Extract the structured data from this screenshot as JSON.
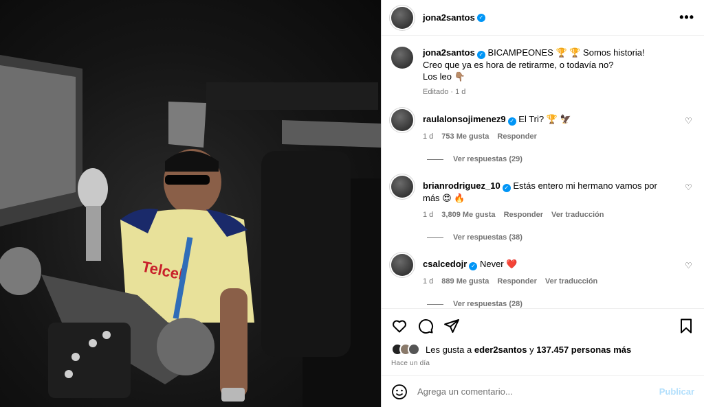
{
  "header": {
    "username": "jona2santos",
    "verified": true,
    "more_icon": "more-horizontal-icon"
  },
  "caption": {
    "username": "jona2santos",
    "line1": "BICAMPEONES 🏆 🏆 Somos historia!",
    "line2": "Creo que ya es hora de retirarme, o todavía no?",
    "line3": "Los leo 👇🏽",
    "meta": "Editado · 1 d"
  },
  "comments": [
    {
      "username": "raulalonsojimenez9",
      "text": "El Tri? 🏆 🦅",
      "time": "1 d",
      "likes": "753 Me gusta",
      "reply": "Responder",
      "translate": "",
      "view_replies": "Ver respuestas (29)"
    },
    {
      "username": "brianrodriguez_10",
      "text": "Estás entero mi hermano vamos por más 😍 🔥",
      "time": "1 d",
      "likes": "3,809 Me gusta",
      "reply": "Responder",
      "translate": "Ver traducción",
      "view_replies": "Ver respuestas (38)"
    },
    {
      "username": "csalcedojr",
      "text": "Never ❤️",
      "time": "1 d",
      "likes": "889 Me gusta",
      "reply": "Responder",
      "translate": "Ver traducción",
      "view_replies": "Ver respuestas (28)"
    }
  ],
  "likes": {
    "prefix": "Les gusta a",
    "first": "eder2santos",
    "middle": "y",
    "count": "137.457 personas más"
  },
  "posted_ago": "Hace un día",
  "composer": {
    "placeholder": "Agrega un comentario...",
    "post_label": "Publicar",
    "emoji_icon": "smiley-icon"
  },
  "colors": {
    "accent": "#0095f6",
    "muted": "#737373",
    "post_disabled": "#b2dffc"
  }
}
